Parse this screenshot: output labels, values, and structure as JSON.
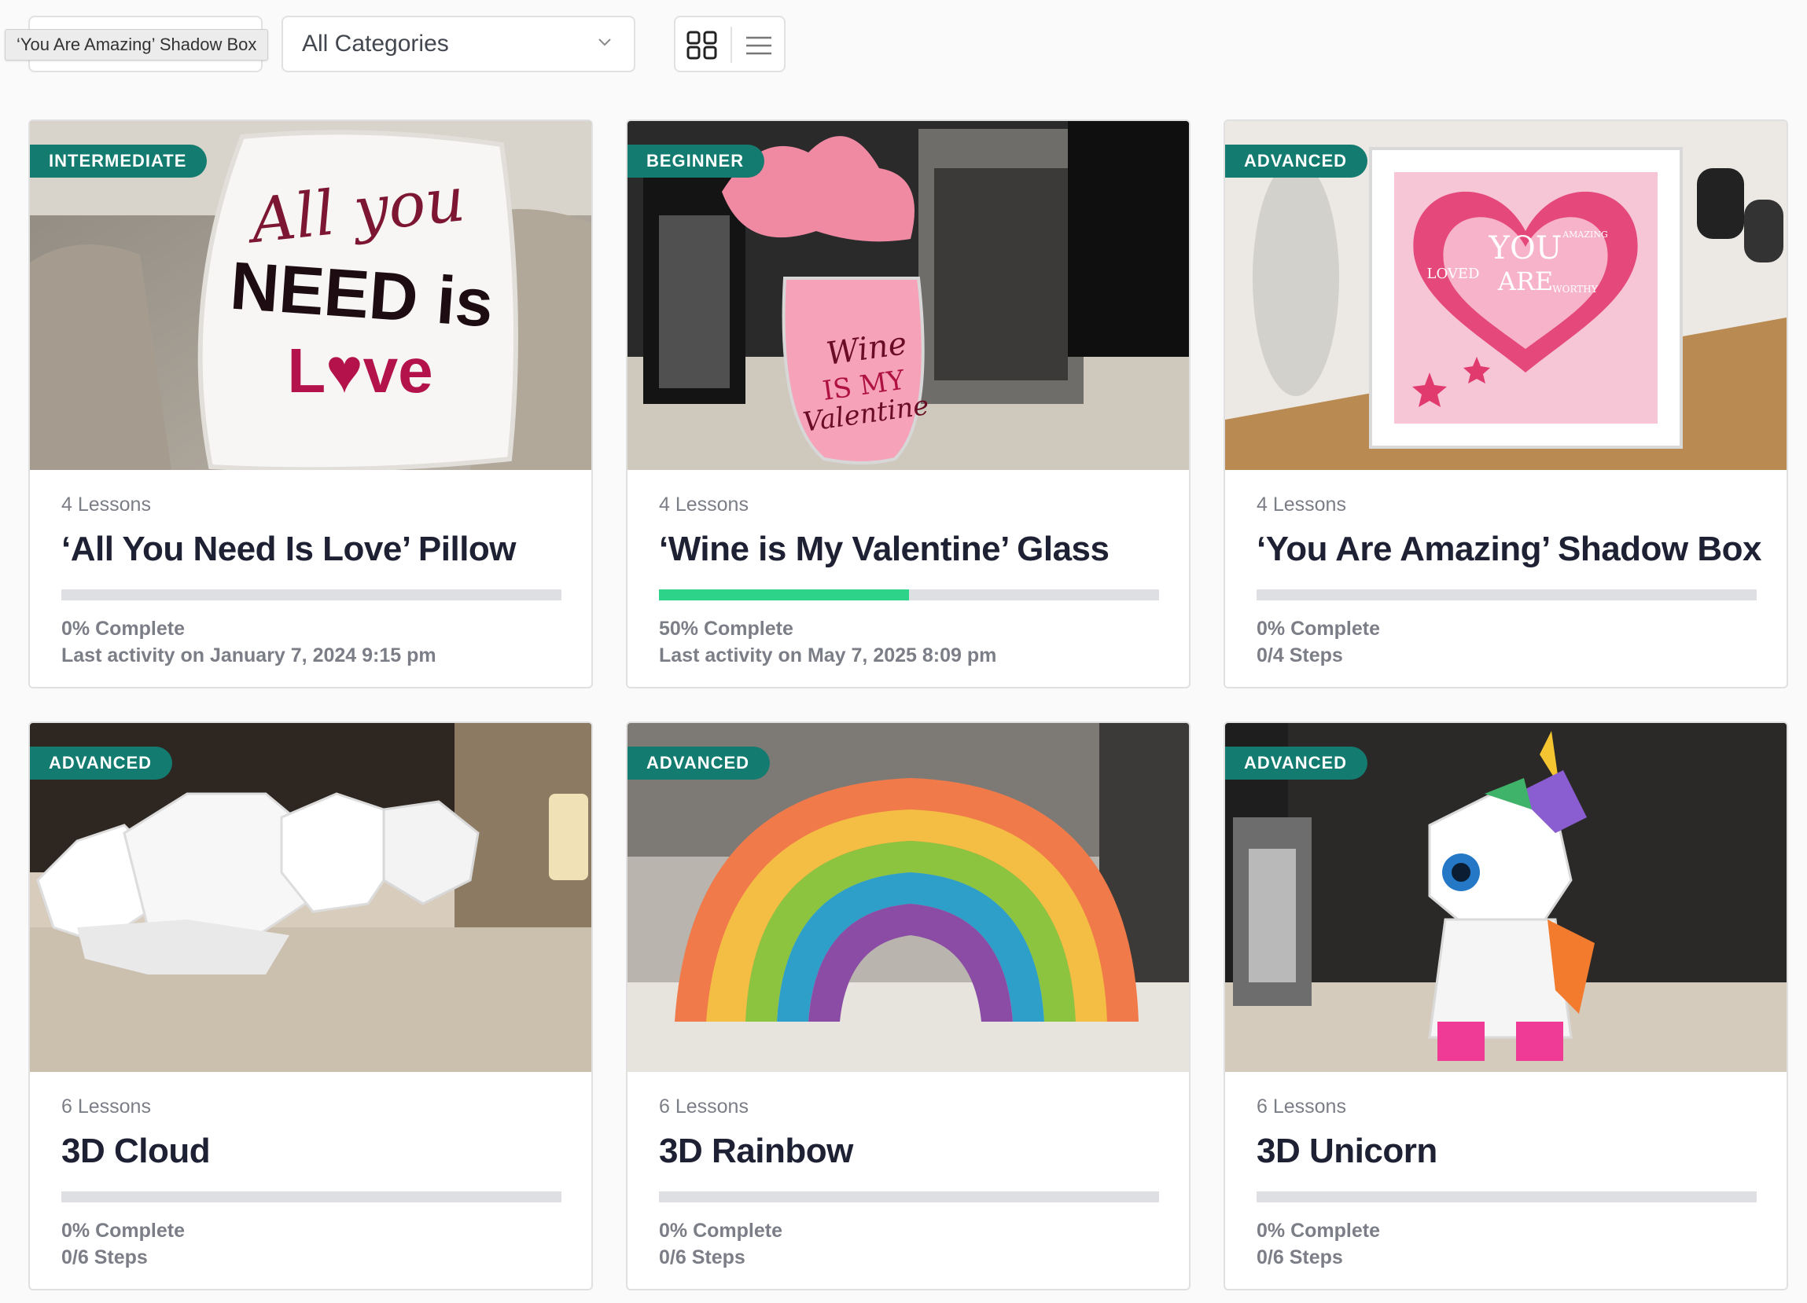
{
  "toolbar": {
    "search_tooltip": "‘You Are Amazing’ Shadow Box",
    "category_select": "All Categories",
    "grid_view_icon": "grid-icon",
    "list_view_icon": "list-icon"
  },
  "colors": {
    "badge": "#137b6f",
    "progress_fill": "#2dd388",
    "progress_track": "#dedfe2"
  },
  "courses": [
    {
      "badge": "INTERMEDIATE",
      "lessons": "4 Lessons",
      "title": "‘All You Need Is Love’ Pillow",
      "progress": 0,
      "complete": "0% Complete",
      "meta": "Last activity on January 7, 2024 9:15 pm",
      "image_text": [
        "All you",
        "NEED is",
        "L♥ve"
      ]
    },
    {
      "badge": "BEGINNER",
      "lessons": "4 Lessons",
      "title": "‘Wine is My Valentine’ Glass",
      "progress": 50,
      "complete": "50% Complete",
      "meta": "Last activity on May 7, 2025 8:09 pm",
      "image_text": [
        "Wine",
        "IS MY",
        "Valentine"
      ]
    },
    {
      "badge": "ADVANCED",
      "lessons": "4 Lessons",
      "title": "‘You Are Amazing’ Shadow Box",
      "progress": 0,
      "complete": "0% Complete",
      "meta": "0/4 Steps",
      "image_text": [
        "YOU",
        "ARE",
        "LOVED",
        "AMAZING",
        "WORTHY"
      ]
    },
    {
      "badge": "ADVANCED",
      "lessons": "6 Lessons",
      "title": "3D Cloud",
      "progress": 0,
      "complete": "0% Complete",
      "meta": "0/6 Steps"
    },
    {
      "badge": "ADVANCED",
      "lessons": "6 Lessons",
      "title": "3D Rainbow",
      "progress": 0,
      "complete": "0% Complete",
      "meta": "0/6 Steps"
    },
    {
      "badge": "ADVANCED",
      "lessons": "6 Lessons",
      "title": "3D Unicorn",
      "progress": 0,
      "complete": "0% Complete",
      "meta": "0/6 Steps"
    }
  ]
}
